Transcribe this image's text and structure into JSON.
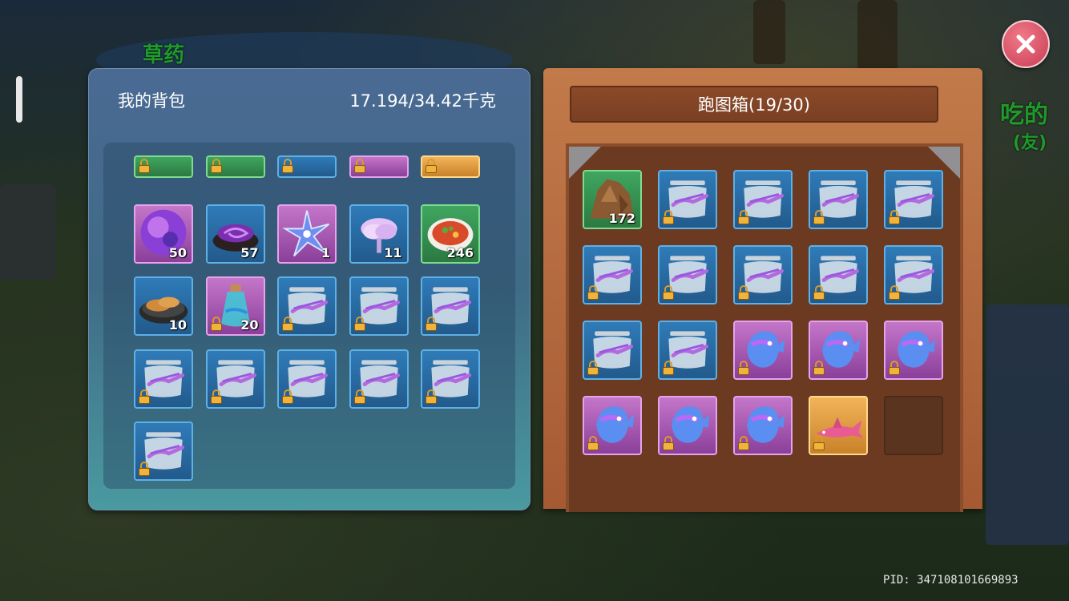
{
  "world": {
    "label_top_left": "草药",
    "label_right": "吃的",
    "label_right_sub": "(友)",
    "pid": "PID: 347108101669893"
  },
  "backpack": {
    "title": "我的背包",
    "weight": "17.194/34.42千克",
    "rows": [
      [
        {
          "color": "green",
          "icon": "partial-item-icon",
          "partial": true
        },
        {
          "color": "green",
          "icon": "partial-item-icon",
          "partial": true
        },
        {
          "color": "blue",
          "icon": "partial-item-icon",
          "partial": true
        },
        {
          "color": "purple",
          "icon": "partial-item-icon",
          "partial": true
        },
        {
          "color": "gold",
          "icon": "partial-item-icon",
          "partial": true
        }
      ],
      [
        {
          "color": "purple",
          "icon": "purple-orb-icon",
          "count": "50"
        },
        {
          "color": "blue",
          "icon": "dark-swirl-icon",
          "count": "57"
        },
        {
          "color": "purple",
          "icon": "crystal-star-icon",
          "count": "1"
        },
        {
          "color": "blue",
          "icon": "lilac-flower-icon",
          "count": "11"
        },
        {
          "color": "green",
          "icon": "soup-bowl-icon",
          "count": "246"
        }
      ],
      [
        {
          "color": "blue",
          "icon": "fried-food-plate-icon",
          "count": "10"
        },
        {
          "color": "purple",
          "icon": "potion-bottle-icon",
          "count": "20",
          "locked": true
        },
        {
          "color": "blue",
          "icon": "fish-tank-icon",
          "locked": true
        },
        {
          "color": "blue",
          "icon": "fish-tank-icon",
          "locked": true
        },
        {
          "color": "blue",
          "icon": "fish-tank-icon",
          "locked": true
        }
      ],
      [
        {
          "color": "blue",
          "icon": "fish-tank-icon",
          "locked": true
        },
        {
          "color": "blue",
          "icon": "fish-tank-icon",
          "locked": true
        },
        {
          "color": "blue",
          "icon": "fish-tank-icon",
          "locked": true
        },
        {
          "color": "blue",
          "icon": "fish-tank-icon",
          "locked": true
        },
        {
          "color": "blue",
          "icon": "fish-tank-icon",
          "locked": true
        }
      ],
      [
        {
          "color": "blue",
          "icon": "fish-tank-icon",
          "locked": true
        }
      ]
    ]
  },
  "chest": {
    "title": "跑图箱(19/30)",
    "rows": [
      [
        {
          "color": "green",
          "icon": "rock-ore-icon",
          "count": "172"
        },
        {
          "color": "blue",
          "icon": "fish-tank-icon",
          "locked": true
        },
        {
          "color": "blue",
          "icon": "fish-tank-icon",
          "locked": true
        },
        {
          "color": "blue",
          "icon": "fish-tank-icon",
          "locked": true
        },
        {
          "color": "blue",
          "icon": "fish-tank-icon",
          "locked": true
        }
      ],
      [
        {
          "color": "blue",
          "icon": "fish-tank-icon",
          "locked": true
        },
        {
          "color": "blue",
          "icon": "fish-tank-icon",
          "locked": true
        },
        {
          "color": "blue",
          "icon": "fish-tank-icon",
          "locked": true
        },
        {
          "color": "blue",
          "icon": "fish-tank-icon",
          "locked": true
        },
        {
          "color": "blue",
          "icon": "fish-tank-icon",
          "locked": true
        }
      ],
      [
        {
          "color": "blue",
          "icon": "fish-tank-icon",
          "locked": true
        },
        {
          "color": "blue",
          "icon": "fish-tank-icon",
          "locked": true
        },
        {
          "color": "purple",
          "icon": "sunfish-icon",
          "locked": true
        },
        {
          "color": "purple",
          "icon": "sunfish-icon",
          "locked": true
        },
        {
          "color": "purple",
          "icon": "sunfish-icon",
          "locked": true
        }
      ],
      [
        {
          "color": "purple",
          "icon": "sunfish-icon",
          "locked": true
        },
        {
          "color": "purple",
          "icon": "sunfish-icon",
          "locked": true
        },
        {
          "color": "purple",
          "icon": "sunfish-icon",
          "locked": true
        },
        {
          "color": "gold",
          "icon": "shark-icon",
          "locked": true
        },
        {
          "color": "empty",
          "icon": "empty-slot"
        }
      ]
    ]
  },
  "colors": {
    "close_button": "#d9485e",
    "blue_slot": "#2f7bb8",
    "purple_slot": "#c476c9",
    "green_slot": "#3fa65f",
    "gold_slot": "#f2b45a",
    "chest_wood": "#b0643a"
  }
}
